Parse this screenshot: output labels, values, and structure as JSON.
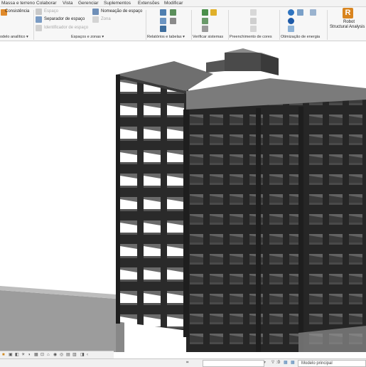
{
  "menu": [
    "Massa e terreno",
    "Colaborar",
    "Vista",
    "Gerenciar",
    "Suplementos",
    "Extensões",
    "Modificar"
  ],
  "ribbon": {
    "consistencia": "Consistência",
    "espaco": "Espaço",
    "separador": "Separador de   espaço",
    "identificador": "Identificador de  espaço",
    "nomeacao": "Nomeação  de espaço",
    "zona": "Zona",
    "robot_line1": "Robot",
    "robot_line2": "Structural Analysis",
    "groups": [
      "odelo analítico ▾",
      "Espaços e zonas ▾",
      "Relatórios e tabelas ▾",
      "Verificar sistemas",
      "Preenchimento de cores",
      "Otimização de energia"
    ]
  },
  "status": {
    "model": "Modelo principal",
    "count": ":0"
  },
  "colors": {
    "ribbon_bg": "#f7f7f7",
    "structure_dark": "#2b2b2b",
    "slab": "#5e5e5e",
    "robot_orange": "#d9851f"
  }
}
